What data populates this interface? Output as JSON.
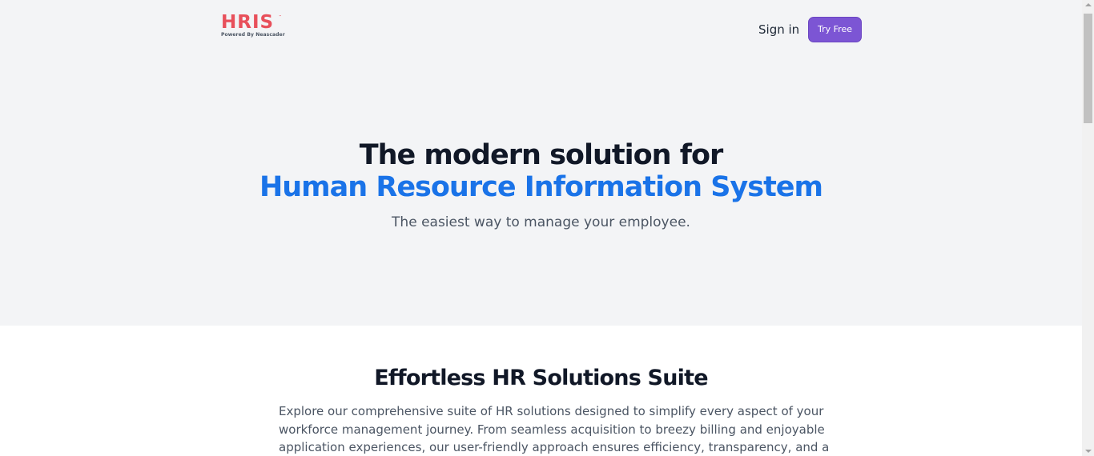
{
  "header": {
    "logo": {
      "word": "HRIS",
      "trademark": "™",
      "tagline": "Powered By Neascader",
      "color": "#e8505b"
    },
    "signin_label": "Sign in",
    "try_free_label": "Try Free",
    "accent_color": "#7c55d4"
  },
  "hero": {
    "title": "The modern solution for",
    "title_accent": "Human Resource Information System",
    "subtitle": "The easiest way to manage your employee.",
    "accent_color": "#1a73e8",
    "background": "#f3f4f6"
  },
  "features": {
    "title": "Effortless HR Solutions Suite",
    "body_lines": [
      "Explore our comprehensive suite of HR solutions designed to simplify every aspect of your",
      "workforce management journey. From seamless acquisition to breezy billing and enjoyable",
      "application experiences, our user-friendly approach ensures efficiency, transparency, and a"
    ]
  },
  "scrollbar": {
    "up_icon": "scroll-up-arrow-icon",
    "down_icon": "scroll-down-arrow-icon"
  }
}
